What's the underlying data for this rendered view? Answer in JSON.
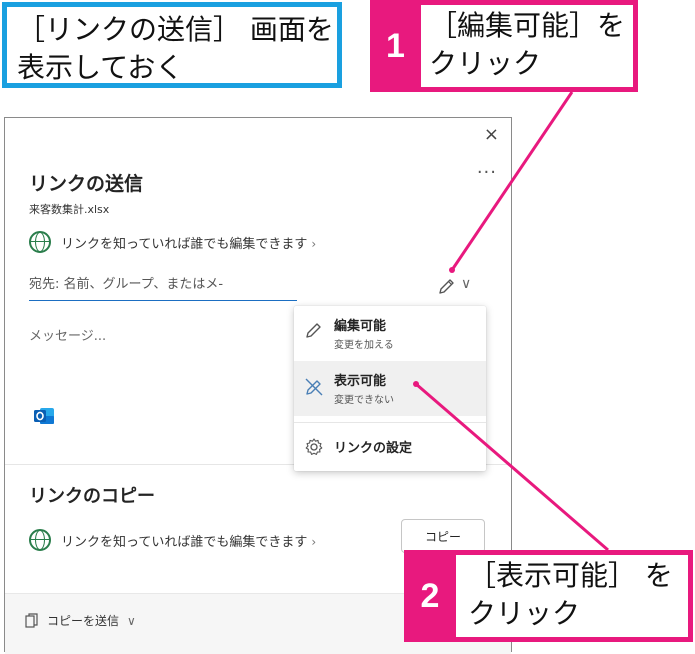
{
  "callouts": {
    "intro": {
      "line1": "［リンクの送信］ 画面を",
      "line2": "表示しておく"
    },
    "step1": {
      "number": "1",
      "line1": "［編集可能］を",
      "line2": "クリック"
    },
    "step2": {
      "number": "2",
      "line1": "［表示可能］ を",
      "line2": "クリック"
    }
  },
  "dialog": {
    "close_glyph": "×",
    "more_glyph": "···",
    "title": "リンクの送信",
    "filename": "来客数集計.xlsx",
    "link_setting": "リンクを知っていれば誰でも編集できます",
    "link_chevron": "›",
    "to_placeholder": "宛先: 名前、グループ、またはメ-",
    "permission_chevron": "∨",
    "message_placeholder": "メッセージ...",
    "copy_section_title": "リンクのコピー",
    "copy_link_setting": "リンクを知っていれば誰でも編集できます",
    "copy_button": "コピー",
    "send_copy": "コピーを送信",
    "send_copy_chevron": "∨"
  },
  "menu": {
    "items": [
      {
        "label": "編集可能",
        "description": "変更を加える",
        "icon": "pencil-icon"
      },
      {
        "label": "表示可能",
        "description": "変更できない",
        "icon": "pencil-off-icon",
        "selected": true
      },
      {
        "label": "リンクの設定",
        "icon": "gear-icon"
      }
    ]
  },
  "colors": {
    "callout_magenta": "#e8197e",
    "callout_blue": "#1aa0e0",
    "globe_green": "#2a7d4b",
    "input_underline": "#1b6ec2",
    "outlook_blue": "#0f78d4"
  }
}
